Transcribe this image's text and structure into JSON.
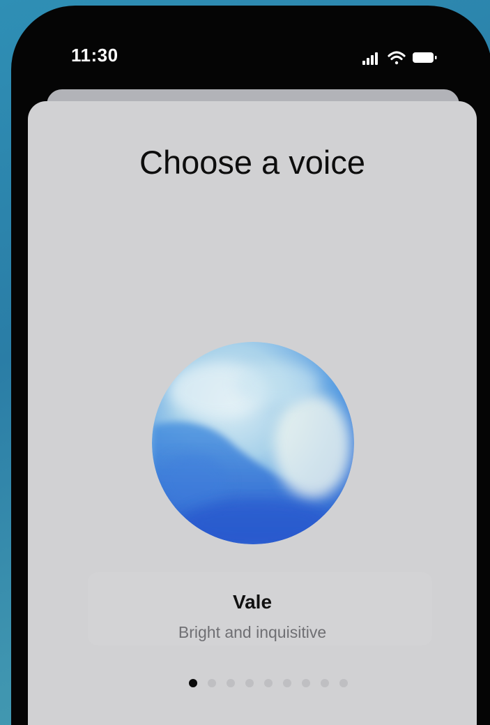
{
  "status_bar": {
    "time": "11:30"
  },
  "screen": {
    "title": "Choose a voice"
  },
  "voice": {
    "name": "Vale",
    "description": "Bright and inquisitive"
  },
  "pager": {
    "total": 9,
    "active_index": 0
  },
  "colors": {
    "sheet": "#d1d1d3",
    "orb_blue": "#2f6fd6",
    "active_dot": "#0a0a0a",
    "inactive_dot": "#bfbfc2"
  },
  "icons": [
    "signal-icon",
    "wifi-icon",
    "battery-icon"
  ]
}
